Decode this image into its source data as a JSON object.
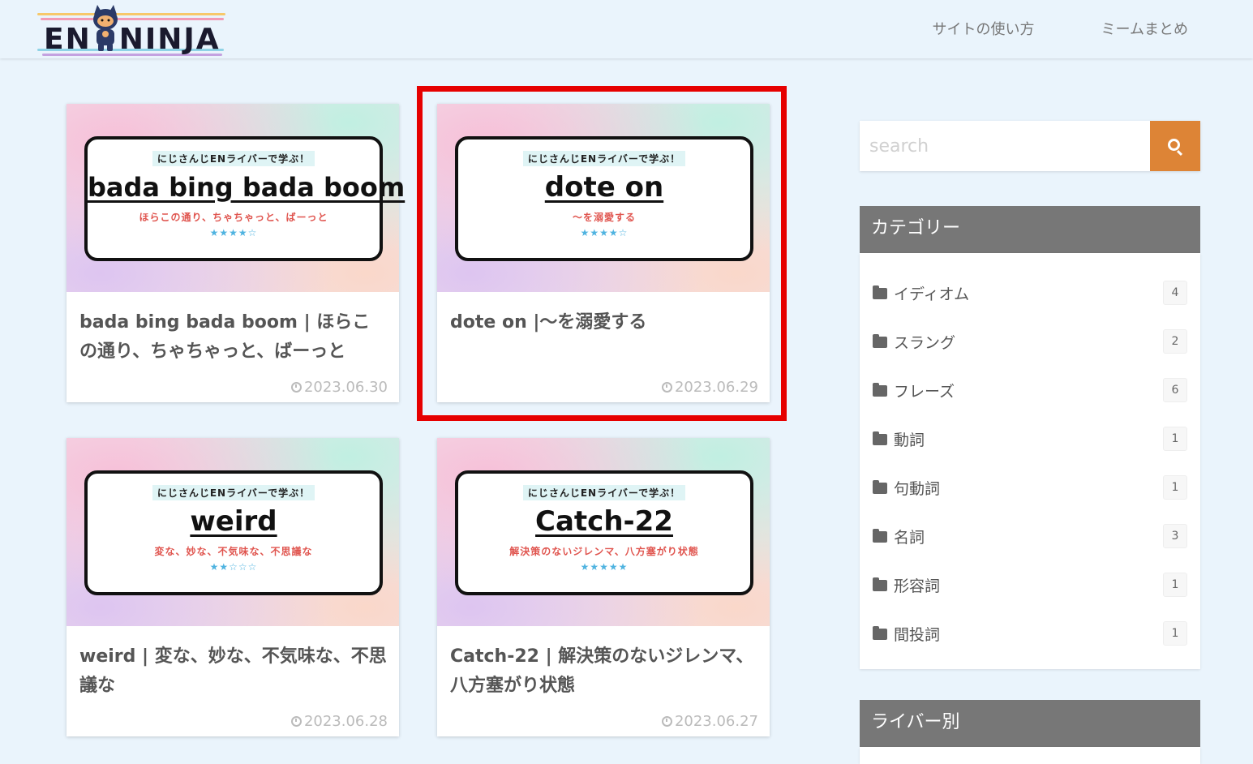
{
  "header": {
    "logo": {
      "text_left": "EN",
      "text_right": "NINJA"
    },
    "nav": [
      "サイトの使い方",
      "ミームまとめ"
    ]
  },
  "cards": [
    {
      "thumb": {
        "badge": "にじさんじENライバーで学ぶ！",
        "word": "bada bing bada boom",
        "sub": "ほらこの通り、ちゃちゃっと、ばーっと",
        "stars": "★★★★☆"
      },
      "title": "bada bing bada boom | ほらこの通り、ちゃちゃっと、ばーっと",
      "date": "2023.06.30"
    },
    {
      "thumb": {
        "badge": "にじさんじENライバーで学ぶ！",
        "word": "dote on",
        "sub": "～を溺愛する",
        "stars": "★★★★☆"
      },
      "title": "dote on |～を溺愛する",
      "date": "2023.06.29"
    },
    {
      "thumb": {
        "badge": "にじさんじENライバーで学ぶ！",
        "word": "weird",
        "sub": "変な、妙な、不気味な、不思議な",
        "stars": "★★☆☆☆"
      },
      "title": "weird | 変な、妙な、不気味な、不思議な",
      "date": "2023.06.28"
    },
    {
      "thumb": {
        "badge": "にじさんじENライバーで学ぶ！",
        "word": "Catch-22",
        "sub": "解決策のないジレンマ、八方塞がり状態",
        "stars": "★★★★★"
      },
      "title": "Catch-22 | 解決策のないジレンマ、八方塞がり状態",
      "date": "2023.06.27"
    }
  ],
  "sidebar": {
    "search": {
      "placeholder": "search"
    },
    "categories": {
      "title": "カテゴリー",
      "items": [
        {
          "label": "イディオム",
          "count": "4"
        },
        {
          "label": "スラング",
          "count": "2"
        },
        {
          "label": "フレーズ",
          "count": "6"
        },
        {
          "label": "動詞",
          "count": "1"
        },
        {
          "label": "句動詞",
          "count": "1"
        },
        {
          "label": "名詞",
          "count": "3"
        },
        {
          "label": "形容詞",
          "count": "1"
        },
        {
          "label": "間投詞",
          "count": "1"
        }
      ]
    },
    "liver_widget": {
      "title": "ライバー別"
    }
  },
  "colors": {
    "background": "#eaf4fc",
    "search_button": "#dd8436",
    "widget_header": "#777777",
    "highlight_border": "#e60000",
    "stars": "#4fb3e0",
    "thumb_subtitle": "#e0554f"
  }
}
